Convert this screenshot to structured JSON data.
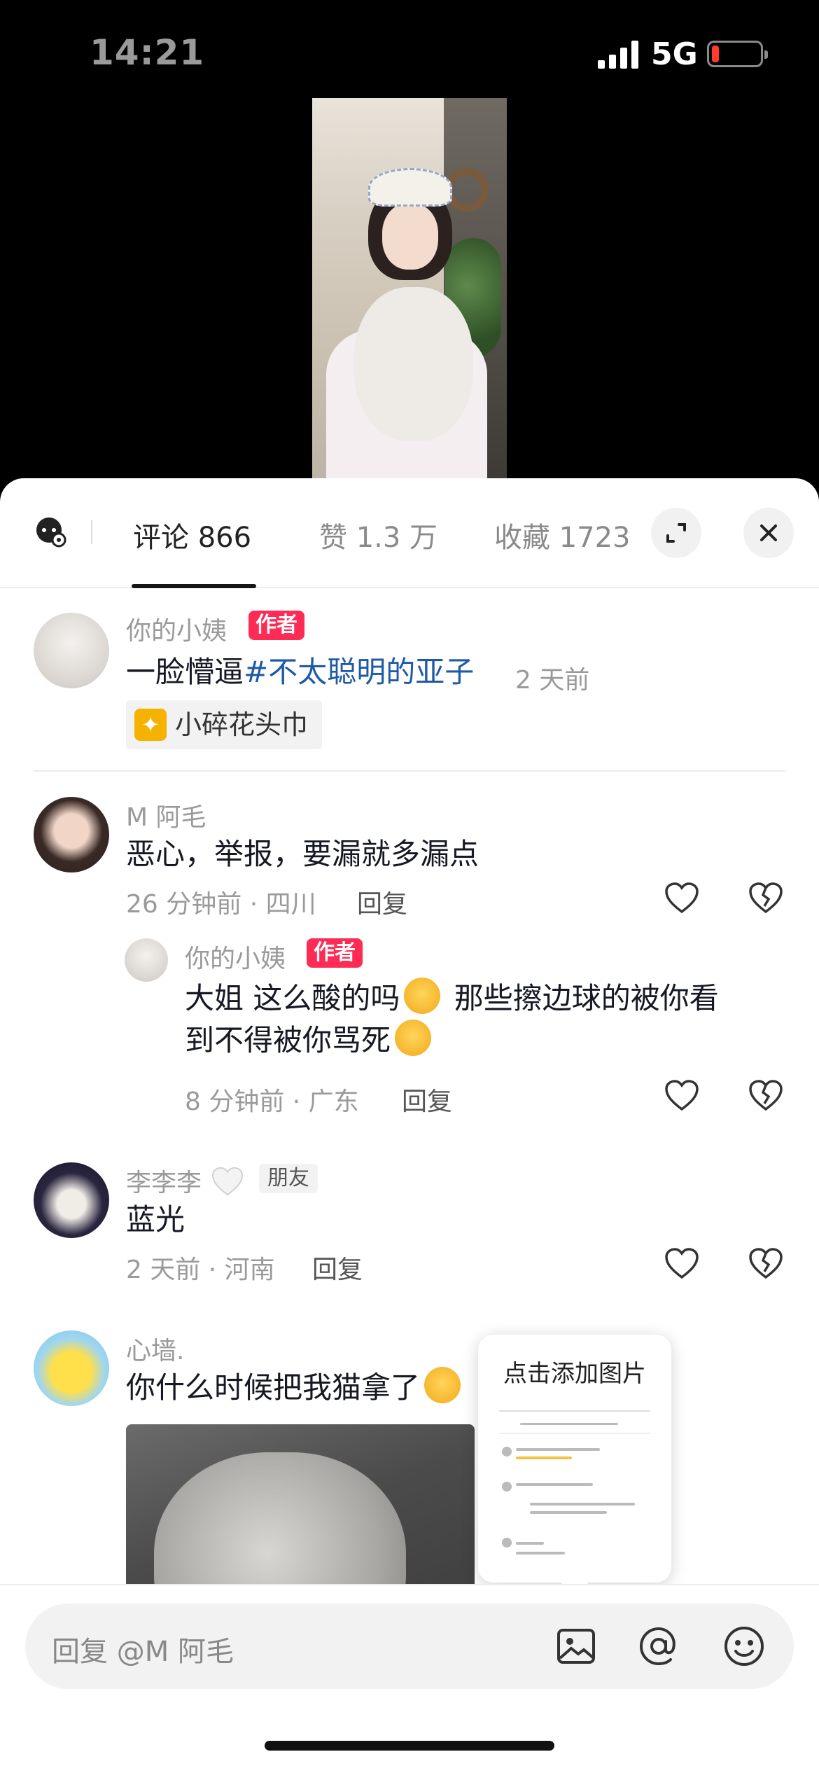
{
  "status": {
    "time": "14:21",
    "network": "5G"
  },
  "tabs": {
    "comments": "评论 866",
    "likes": "赞 1.3 万",
    "favorites": "收藏 1723"
  },
  "comments": [
    {
      "user": "你的小姨",
      "badge": "作者",
      "text_plain": "一脸懵逼",
      "text_hashtag": "#不太聪明的亚子",
      "time": "2 天前",
      "chip": "小碎花头巾"
    },
    {
      "user": "M 阿毛",
      "text": "恶心，举报，要漏就多漏点",
      "meta": "26 分钟前 · 四川",
      "reply_label": "回复",
      "reply": {
        "user": "你的小姨",
        "badge": "作者",
        "text_line1a": "大姐 这么酸的吗",
        "text_line1b": "那些擦边球的被你看",
        "text_line2": "到不得被你骂死",
        "meta": "8 分钟前 · 广东",
        "reply_label": "回复"
      }
    },
    {
      "user": "李李李",
      "badge": "朋友",
      "text": "蓝光",
      "meta": "2 天前 · 河南",
      "reply_label": "回复"
    },
    {
      "user": "心墙.",
      "text": "你什么时候把我猫拿了"
    }
  ],
  "popup": {
    "title": "点击添加图片"
  },
  "input": {
    "placeholder": "回复 @M 阿毛"
  }
}
